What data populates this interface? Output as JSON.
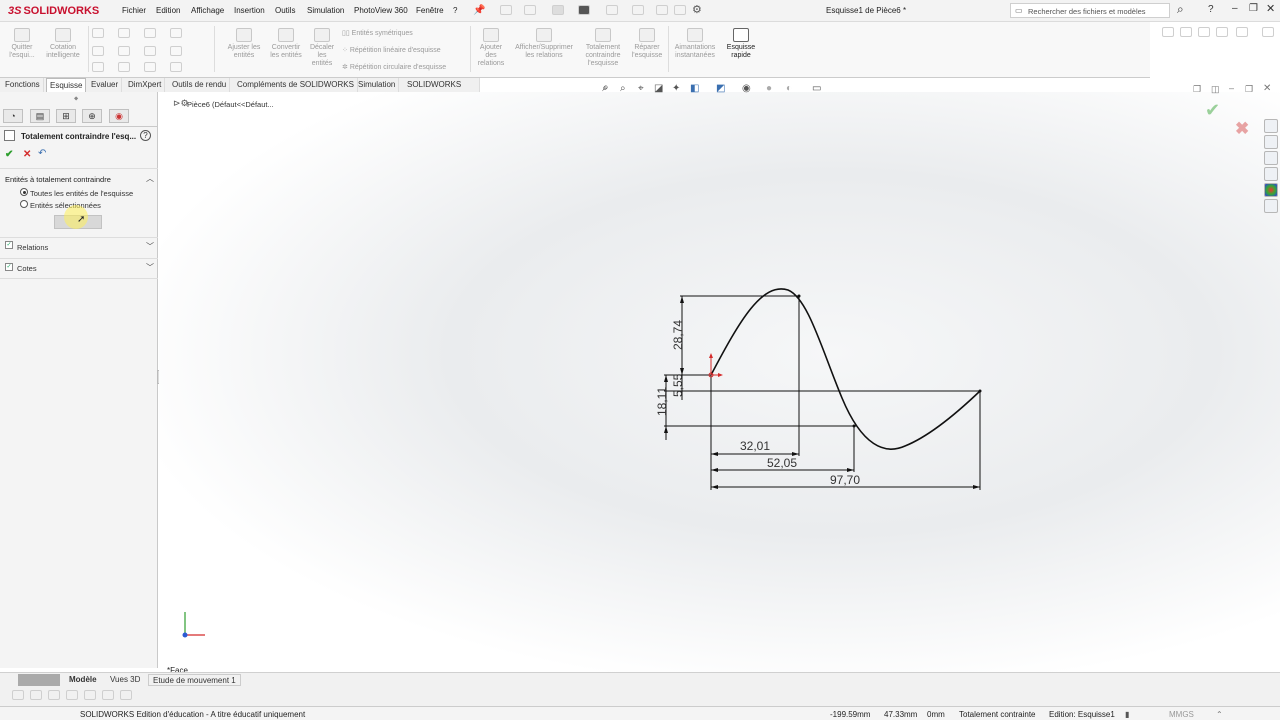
{
  "app": {
    "logo_text": "SOLIDWORKS",
    "window_title": "Esquisse1 de Pièce6 *",
    "search_placeholder": "Rechercher des fichiers et modèles",
    "help_label": "?"
  },
  "menus": [
    "Fichier",
    "Edition",
    "Affichage",
    "Insertion",
    "Outils",
    "Simulation",
    "PhotoView 360",
    "Fenêtre",
    "?"
  ],
  "ribbon": {
    "quit_sketch": [
      "Quitter",
      "l'esqui..."
    ],
    "smart_dim": [
      "Cotation",
      "intelligente"
    ],
    "trim": [
      "Ajuster les",
      "entités"
    ],
    "convert": [
      "Convertir",
      "les entités"
    ],
    "offset": [
      "Décaler",
      "les",
      "entités"
    ],
    "mirror": "Entités symétriques",
    "linear_pattern": "Répétition linéaire d'esquisse",
    "circular_pattern": "Répétition circulaire d'esquisse",
    "add_relation": [
      "Ajouter",
      "des",
      "relations"
    ],
    "show_relations": [
      "Afficher/Supprimer",
      "les relations"
    ],
    "fully_define": [
      "Totalement",
      "contraindre",
      "l'esquisse"
    ],
    "repair": [
      "Réparer",
      "l'esquisse"
    ],
    "snaps": [
      "Aimantations",
      "instantanées"
    ],
    "rapid_sketch": [
      "Esquisse",
      "rapide"
    ]
  },
  "command_tabs": [
    {
      "label": "Fonctions"
    },
    {
      "label": "Esquisse",
      "active": true
    },
    {
      "label": "Evaluer"
    },
    {
      "label": "DimXpert"
    },
    {
      "label": "Outils de rendu"
    },
    {
      "label": "Compléments de SOLIDWORKS"
    },
    {
      "label": "Simulation"
    },
    {
      "label": "SOLIDWORKS MBD"
    }
  ],
  "property_manager": {
    "title": "Totalement contraindre l'esq...",
    "help": "?",
    "section_entities": "Entités à totalement contraindre",
    "radio_all": "Toutes les entités de l'esquisse",
    "radio_selected": "Entités sélectionnées",
    "section_relations": "Relations",
    "section_dims": "Cotes"
  },
  "feature_tree": {
    "part_label": "Pièce6  (Défaut<<Défaut..."
  },
  "viewport": {
    "view_label": "*Face"
  },
  "dimensions": {
    "d1": "28,74",
    "d2": "5,55",
    "d3": "18,11",
    "d4": "32,01",
    "d5": "52,05",
    "d6": "97,70"
  },
  "bottom_tabs": {
    "model": "Modèle",
    "views3d": "Vues 3D",
    "motion": "Etude de mouvement 1"
  },
  "status": {
    "edition": "SOLIDWORKS Edition d'éducation - A titre éducatif uniquement",
    "x": "-199.59mm",
    "y": "47.33mm",
    "z": "0mm",
    "state": "Totalement contrainte",
    "editing": "Edition: Esquisse1",
    "units": "MMGS"
  },
  "colors": {
    "brand": "#c8102e",
    "confirm": "#2e9e2e",
    "cancel": "#d42b2b"
  }
}
